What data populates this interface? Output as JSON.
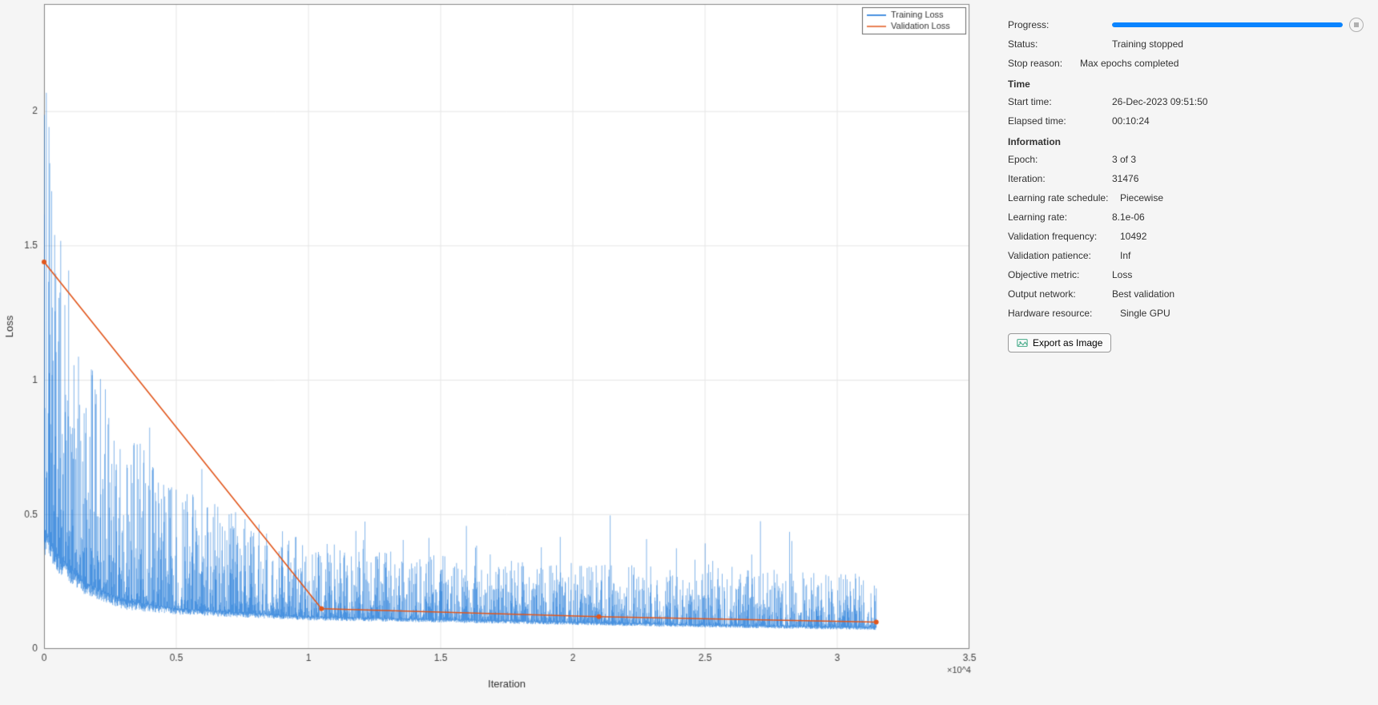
{
  "chart_data": {
    "type": "line",
    "title": "",
    "xlabel": "Iteration",
    "ylabel": "Loss",
    "xlim": [
      0,
      35000
    ],
    "ylim": [
      0,
      2.4
    ],
    "x_exponent_label": "×10^4",
    "x_ticks": [
      0,
      5000,
      10000,
      15000,
      20000,
      25000,
      30000,
      35000
    ],
    "x_tick_labels": [
      "0",
      "0.5",
      "1",
      "1.5",
      "2",
      "2.5",
      "3",
      "3.5"
    ],
    "y_ticks": [
      0,
      0.5,
      1,
      1.5,
      2
    ],
    "y_tick_labels": [
      "0",
      "0.5",
      "1",
      "1.5",
      "2"
    ],
    "legend": [
      "Training Loss",
      "Validation Loss"
    ],
    "series": [
      {
        "name": "Training Loss",
        "color": "#0a6dd6",
        "style": "noisy_envelope",
        "envelope_anchors_x": [
          0,
          500,
          1500,
          3000,
          5000,
          10000,
          15000,
          20000,
          25000,
          31476
        ],
        "upper_y": [
          2.4,
          1.65,
          1.15,
          0.85,
          0.6,
          0.4,
          0.35,
          0.32,
          0.3,
          0.28
        ],
        "lower_y": [
          0.45,
          0.35,
          0.25,
          0.18,
          0.15,
          0.12,
          0.11,
          0.1,
          0.09,
          0.08
        ],
        "x_range_iterations": [
          0,
          31476
        ]
      },
      {
        "name": "Validation Loss",
        "color": "#e2561b",
        "style": "line_with_markers",
        "x": [
          0,
          10492,
          20984,
          31476
        ],
        "values": [
          1.44,
          0.15,
          0.12,
          0.1
        ]
      }
    ]
  },
  "side": {
    "progress_label": "Progress:",
    "progress_pct": 100,
    "status_label": "Status:",
    "status_value": "Training stopped",
    "stop_reason_label": "Stop reason:",
    "stop_reason_value": "Max epochs completed",
    "time_section": "Time",
    "start_time_label": "Start time:",
    "start_time_value": "26-Dec-2023 09:51:50",
    "elapsed_label": "Elapsed time:",
    "elapsed_value": "00:10:24",
    "info_section": "Information",
    "epoch_label": "Epoch:",
    "epoch_value": "3 of 3",
    "iteration_label": "Iteration:",
    "iteration_value": "31476",
    "lr_schedule_label": "Learning rate schedule:",
    "lr_schedule_value": "Piecewise",
    "lr_label": "Learning rate:",
    "lr_value": "8.1e-06",
    "val_freq_label": "Validation frequency:",
    "val_freq_value": "10492",
    "val_patience_label": "Validation patience:",
    "val_patience_value": "Inf",
    "obj_metric_label": "Objective metric:",
    "obj_metric_value": "Loss",
    "out_net_label": "Output network:",
    "out_net_value": "Best validation",
    "hw_label": "Hardware resource:",
    "hw_value": "Single GPU",
    "export_label": "Export as Image"
  }
}
